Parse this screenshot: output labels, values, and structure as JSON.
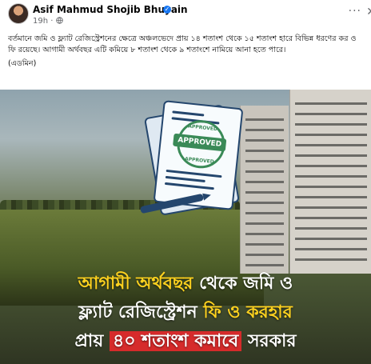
{
  "post": {
    "author": "Asif Mahmud Shojib Bhuyain",
    "verified_mark": "✓",
    "time": "19h",
    "separator": "·",
    "audience_icon": "globe-icon",
    "more_label": "···",
    "close_label": "✕",
    "text": "বর্তমানে জমি ও ফ্ল্যাট রেজিস্ট্রেশনের ক্ষেত্রে অঞ্চলভেদে প্রায় ১৪ শতাংশ থেকে ১৫ শতাংশ হারে বিভিন্ন ধরণের কর ও ফি রয়েছে। আগামী অর্থবছর এটি কমিয়ে ৮ শতাংশ থেকে ৯ শতাংশে নামিয়ে আনা হতে পারে।",
    "signature": "(এডমিন)"
  },
  "media": {
    "stamp_top": "APPROVED",
    "stamp_label": "APPROVED",
    "stamp_bottom": "APPROVED",
    "headline": {
      "line1_part1": "আগামী অর্থবছর",
      "line1_part2": " থেকে জমি ও",
      "line2_part1": "ফ্ল্যাট রেজিস্ট্রেশন ",
      "line2_part2": "ফি ও করহার",
      "line3_part1": "প্রায় ",
      "line3_part2": "৪০ শতাংশ কমাবে",
      "line3_part3": " সরকার"
    }
  }
}
